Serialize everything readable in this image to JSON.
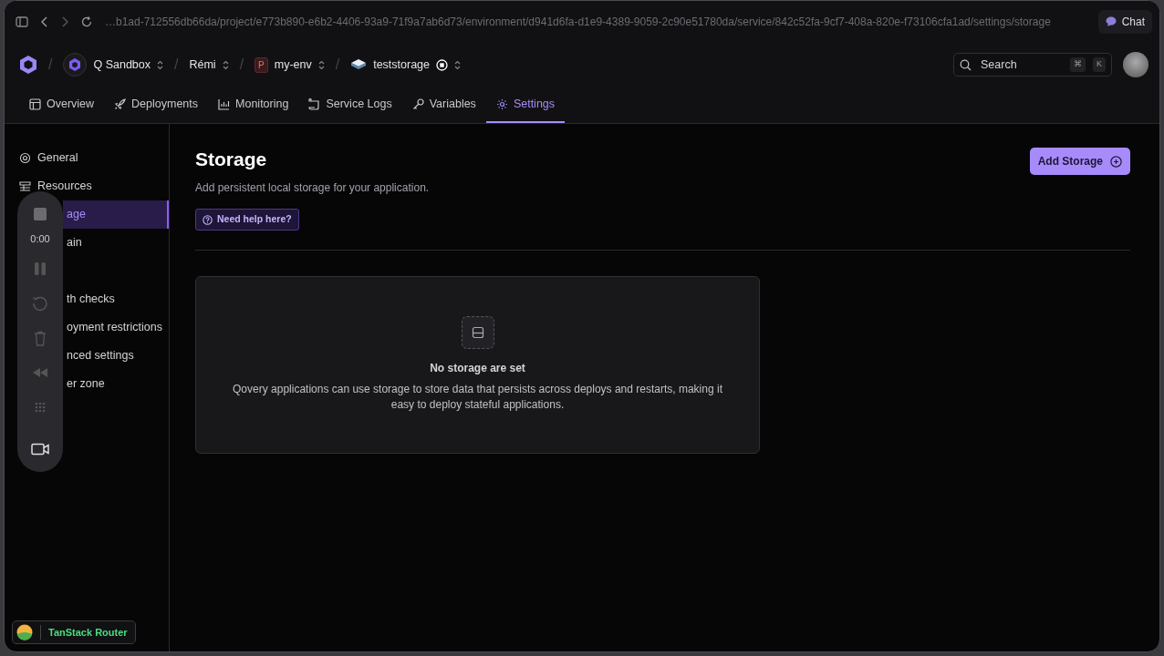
{
  "browser": {
    "url": "…b1ad-712556db66da/project/e773b890-e6b2-4406-93a9-71f9a7ab6d73/environment/d941d6fa-d1e9-4389-9059-2c90e51780da/service/842c52fa-9cf7-408a-820e-f73106cfa1ad/settings/storage",
    "chat_button": "Chat"
  },
  "breadcrumbs": [
    {
      "kind": "org",
      "separator": "/",
      "label": "Q Sandbox"
    },
    {
      "kind": "plain",
      "separator": "/",
      "label": "Rémi"
    },
    {
      "kind": "project",
      "separator": "/",
      "badge": "P",
      "label": "my-env"
    },
    {
      "kind": "service",
      "separator": "/",
      "label": "teststorage"
    }
  ],
  "search": {
    "placeholder": "Search",
    "keys": [
      "⌘",
      "K"
    ]
  },
  "tabs": [
    {
      "label": "Overview",
      "selected": false
    },
    {
      "label": "Deployments",
      "selected": false
    },
    {
      "label": "Monitoring",
      "selected": false
    },
    {
      "label": "Service Logs",
      "selected": false
    },
    {
      "label": "Variables",
      "selected": false
    },
    {
      "label": "Settings",
      "selected": true
    }
  ],
  "sidebar": {
    "items": [
      {
        "label": "General",
        "selected": false
      },
      {
        "label": "Resources",
        "selected": false
      },
      {
        "label": "age",
        "selected": true
      },
      {
        "label": "ain",
        "selected": false
      },
      {
        "label": "th checks",
        "selected": false
      },
      {
        "label": "oyment restrictions",
        "selected": false
      },
      {
        "label": "nced settings",
        "selected": false
      },
      {
        "label": "er zone",
        "selected": false
      }
    ]
  },
  "page": {
    "title": "Storage",
    "subtitle": "Add persistent local storage for your application.",
    "help_button": "Need help here?",
    "add_button": "Add Storage",
    "empty_state": {
      "title": "No storage are set",
      "text": "Qovery applications can use storage to store data that persists across deploys and restarts, making it easy to deploy stateful applications."
    }
  },
  "recorder": {
    "time": "0:00"
  },
  "devtools": {
    "label": "TanStack Router"
  }
}
